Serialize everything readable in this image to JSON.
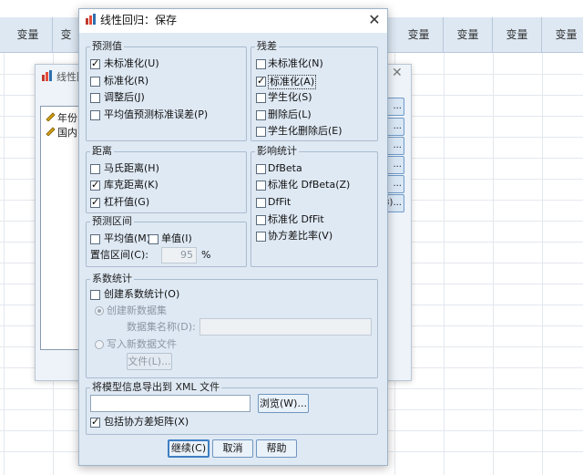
{
  "spreadsheet": {
    "columns": [
      "变量",
      "变",
      "变量",
      "变量",
      "变量",
      "变量"
    ]
  },
  "back_dialog": {
    "title": "线性回",
    "variables": [
      "年份",
      "国内"
    ],
    "side_buttons": [
      "...",
      "...",
      "...",
      "...",
      "...",
      "3)..."
    ]
  },
  "dialog": {
    "title": "线性回归：保存",
    "close": "✕",
    "predicted": {
      "title": "预测值",
      "items": [
        {
          "label": "未标准化(U)",
          "checked": true
        },
        {
          "label": "标准化(R)",
          "checked": false
        },
        {
          "label": "调整后(J)",
          "checked": false
        },
        {
          "label": "平均值预测标准误差(P)",
          "checked": false
        }
      ]
    },
    "residuals": {
      "title": "残差",
      "items": [
        {
          "label": "未标准化(N)",
          "checked": false
        },
        {
          "label": "标准化(A)",
          "checked": true
        },
        {
          "label": "学生化(S)",
          "checked": false
        },
        {
          "label": "删除后(L)",
          "checked": false
        },
        {
          "label": "学生化删除后(E)",
          "checked": false
        }
      ]
    },
    "distances": {
      "title": "距离",
      "items": [
        {
          "label": "马氏距离(H)",
          "checked": false
        },
        {
          "label": "库克距离(K)",
          "checked": true
        },
        {
          "label": "杠杆值(G)",
          "checked": true
        }
      ]
    },
    "influence": {
      "title": "影响统计",
      "items": [
        {
          "label": "DfBeta",
          "checked": false
        },
        {
          "label": "标准化 DfBeta(Z)",
          "checked": false
        },
        {
          "label": "DfFit",
          "checked": false
        },
        {
          "label": "标准化 DfFit",
          "checked": false
        },
        {
          "label": "协方差比率(V)",
          "checked": false
        }
      ]
    },
    "pred_interval": {
      "title": "预测区间",
      "mean_label": "平均值(M)",
      "mean_checked": false,
      "individual_label": "单值(I)",
      "individual_checked": false,
      "confidence_label": "置信区间(C):",
      "confidence_value": "95",
      "percent": "%"
    },
    "coef": {
      "title": "系数统计",
      "create_label": "创建系数统计(O)",
      "create_checked": false,
      "new_dataset_label": "创建新数据集",
      "dataset_name_label": "数据集名称(D):",
      "dataset_name_value": "",
      "write_file_label": "写入新数据文件",
      "file_button": "文件(L)..."
    },
    "export": {
      "title": "将模型信息导出到 XML 文件",
      "path_value": "",
      "browse_button": "浏览(W)...",
      "include_cov_label": "包括协方差矩阵(X)",
      "include_cov_checked": true
    },
    "buttons": {
      "continue": "继续(C)",
      "cancel": "取消",
      "help": "帮助"
    }
  }
}
